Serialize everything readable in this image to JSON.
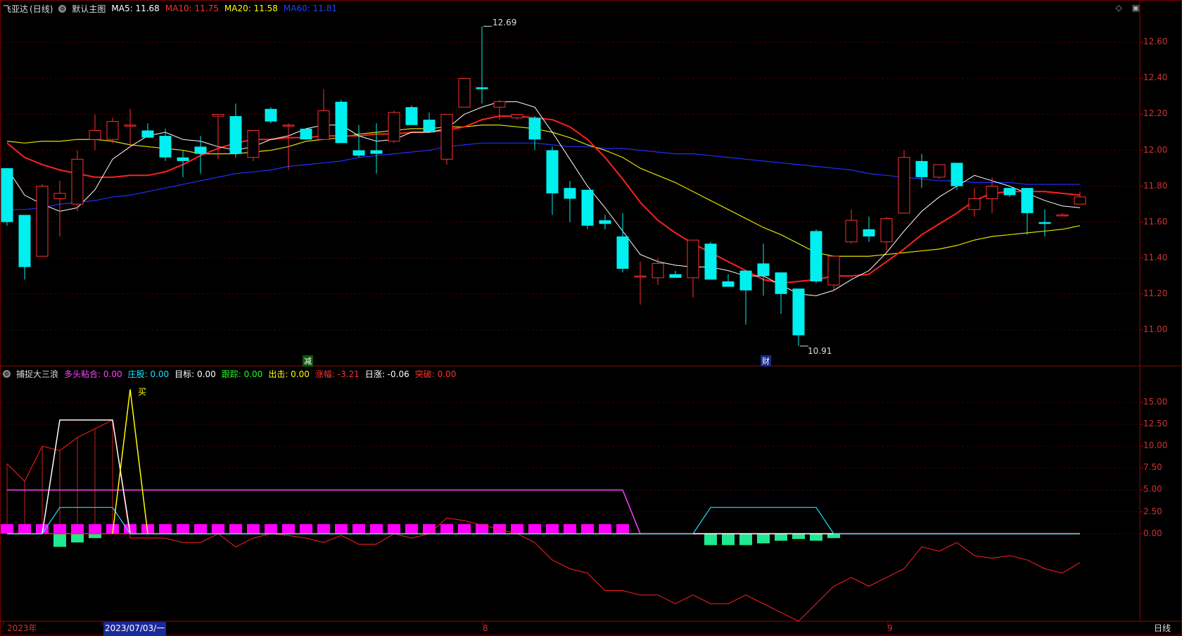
{
  "header": {
    "stock": "飞亚达",
    "period": "(日线)",
    "template": "默认主图",
    "ma": [
      {
        "label": "MA5: 11.68",
        "color": "#ffffff"
      },
      {
        "label": "MA10: 11.75",
        "color": "#ff3030"
      },
      {
        "label": "MA20: 11.58",
        "color": "#ffff00"
      },
      {
        "label": "MA60: 11.81",
        "color": "#2040ff"
      }
    ]
  },
  "sub_header": {
    "name": "捕捉大三浪",
    "items": [
      {
        "label": "多头粘合: 0.00",
        "color": "#ff40ff"
      },
      {
        "label": "庄股: 0.00",
        "color": "#20e0ff"
      },
      {
        "label": "目标: 0.00",
        "color": "#ffffff"
      },
      {
        "label": "跟踪: 0.00",
        "color": "#20ff20"
      },
      {
        "label": "出击: 0.00",
        "color": "#ffff00"
      },
      {
        "label": "涨幅: -3.21",
        "color": "#ff3030"
      },
      {
        "label": "日涨: -0.06",
        "color": "#ffffff"
      },
      {
        "label": "突破: 0.00",
        "color": "#ff3030"
      }
    ]
  },
  "annotations": {
    "high": "12.69",
    "low": "10.91",
    "buy": "买",
    "jian": "减",
    "cai": "财"
  },
  "bottom": {
    "year": "2023年",
    "date": "2023/07/03/一",
    "m8": "8",
    "m9": "9",
    "period_btn": "日线"
  },
  "chart_data": [
    {
      "type": "candlestick",
      "ylim": [
        10.8,
        12.75
      ],
      "yticks": [
        "12.60",
        "12.40",
        "12.20",
        "12.00",
        "11.80",
        "11.60",
        "11.40",
        "11.20",
        "11.00"
      ],
      "candles": [
        [
          11.9,
          11.9,
          11.58,
          11.6
        ],
        [
          11.64,
          11.6,
          11.28,
          11.35
        ],
        [
          11.41,
          11.81,
          11.41,
          11.8
        ],
        [
          11.73,
          11.83,
          11.52,
          11.76
        ],
        [
          11.7,
          12.0,
          11.66,
          11.95
        ],
        [
          12.06,
          12.2,
          12.0,
          12.11
        ],
        [
          12.06,
          12.18,
          12.04,
          12.16
        ],
        [
          12.14,
          12.23,
          12.02,
          12.14
        ],
        [
          12.11,
          12.15,
          12.07,
          12.07
        ],
        [
          12.08,
          12.12,
          11.94,
          11.96
        ],
        [
          11.96,
          12.0,
          11.85,
          11.94
        ],
        [
          12.02,
          12.08,
          11.87,
          11.98
        ],
        [
          12.19,
          12.2,
          11.95,
          12.2
        ],
        [
          12.19,
          12.26,
          11.96,
          11.98
        ],
        [
          11.96,
          12.09,
          11.94,
          12.11
        ],
        [
          12.23,
          12.24,
          12.15,
          12.16
        ],
        [
          12.14,
          12.15,
          11.89,
          12.14
        ],
        [
          12.12,
          12.12,
          12.06,
          12.06
        ],
        [
          12.06,
          12.34,
          12.06,
          12.22
        ],
        [
          12.27,
          12.28,
          12.04,
          12.04
        ],
        [
          12.0,
          12.14,
          11.96,
          11.97
        ],
        [
          12.0,
          12.15,
          11.87,
          11.98
        ],
        [
          12.05,
          12.22,
          12.04,
          12.21
        ],
        [
          12.24,
          12.25,
          12.14,
          12.14
        ],
        [
          12.17,
          12.21,
          12.13,
          12.1
        ],
        [
          11.95,
          12.2,
          11.92,
          12.2
        ],
        [
          12.24,
          12.4,
          12.24,
          12.4
        ],
        [
          12.35,
          12.69,
          12.26,
          12.34
        ],
        [
          12.24,
          12.28,
          12.17,
          12.27
        ],
        [
          12.18,
          12.2,
          12.17,
          12.2
        ],
        [
          12.18,
          12.19,
          12.0,
          12.06
        ],
        [
          12.0,
          12.02,
          11.64,
          11.76
        ],
        [
          11.79,
          11.83,
          11.6,
          11.73
        ],
        [
          11.78,
          11.78,
          11.56,
          11.58
        ],
        [
          11.61,
          11.64,
          11.56,
          11.59
        ],
        [
          11.52,
          11.65,
          11.32,
          11.34
        ],
        [
          11.3,
          11.38,
          11.14,
          11.3
        ],
        [
          11.29,
          11.4,
          11.25,
          11.37
        ],
        [
          11.31,
          11.33,
          11.3,
          11.29
        ],
        [
          11.29,
          11.5,
          11.18,
          11.5
        ],
        [
          11.48,
          11.49,
          11.3,
          11.28
        ],
        [
          11.27,
          11.31,
          11.24,
          11.24
        ],
        [
          11.33,
          11.33,
          11.03,
          11.22
        ],
        [
          11.37,
          11.48,
          11.19,
          11.3
        ],
        [
          11.32,
          11.31,
          11.09,
          11.2
        ],
        [
          11.23,
          11.22,
          10.91,
          10.97
        ],
        [
          11.55,
          11.56,
          11.26,
          11.27
        ],
        [
          11.25,
          11.4,
          11.22,
          11.41
        ],
        [
          11.49,
          11.67,
          11.48,
          11.61
        ],
        [
          11.56,
          11.63,
          11.49,
          11.52
        ],
        [
          11.49,
          11.63,
          11.44,
          11.62
        ],
        [
          11.65,
          12.0,
          11.65,
          11.96
        ],
        [
          11.94,
          11.98,
          11.79,
          11.85
        ],
        [
          11.85,
          11.92,
          11.84,
          11.92
        ],
        [
          11.93,
          11.91,
          11.78,
          11.8
        ],
        [
          11.67,
          11.79,
          11.63,
          11.73
        ],
        [
          11.73,
          11.85,
          11.65,
          11.8
        ],
        [
          11.79,
          11.79,
          11.74,
          11.75
        ],
        [
          11.79,
          11.77,
          11.53,
          11.65
        ],
        [
          11.6,
          11.67,
          11.52,
          11.59
        ],
        [
          11.64,
          11.65,
          11.64,
          11.64
        ],
        [
          11.7,
          11.77,
          11.71,
          11.74
        ]
      ],
      "ma5": [
        11.9,
        11.75,
        11.7,
        11.66,
        11.68,
        11.78,
        11.95,
        12.02,
        12.08,
        12.1,
        12.06,
        12.05,
        12.02,
        12.0,
        12.02,
        12.06,
        12.08,
        12.12,
        12.14,
        12.14,
        12.08,
        12.05,
        12.06,
        12.1,
        12.1,
        12.12,
        12.2,
        12.24,
        12.27,
        12.27,
        12.24,
        12.1,
        11.95,
        11.8,
        11.68,
        11.55,
        11.42,
        11.38,
        11.36,
        11.35,
        11.35,
        11.33,
        11.3,
        11.3,
        11.25,
        11.2,
        11.19,
        11.22,
        11.28,
        11.33,
        11.43,
        11.55,
        11.66,
        11.74,
        11.8,
        11.86,
        11.83,
        11.8,
        11.76,
        11.72,
        11.69,
        11.68
      ],
      "ma10": [
        12.04,
        11.96,
        11.92,
        11.89,
        11.87,
        11.85,
        11.85,
        11.86,
        11.86,
        11.88,
        11.92,
        11.97,
        12.01,
        12.04,
        12.06,
        12.06,
        12.07,
        12.07,
        12.08,
        12.08,
        12.08,
        12.09,
        12.09,
        12.1,
        12.1,
        12.11,
        12.13,
        12.17,
        12.19,
        12.19,
        12.18,
        12.17,
        12.13,
        12.06,
        11.96,
        11.84,
        11.71,
        11.61,
        11.54,
        11.48,
        11.43,
        11.38,
        11.33,
        11.28,
        11.26,
        11.27,
        11.28,
        11.3,
        11.3,
        11.31,
        11.38,
        11.45,
        11.53,
        11.59,
        11.65,
        11.72,
        11.76,
        11.77,
        11.77,
        11.77,
        11.76,
        11.75
      ],
      "ma20": [
        12.05,
        12.04,
        12.05,
        12.05,
        12.06,
        12.06,
        12.05,
        12.03,
        12.02,
        12.01,
        12.0,
        11.98,
        11.98,
        11.98,
        11.99,
        12.0,
        12.02,
        12.05,
        12.06,
        12.07,
        12.09,
        12.1,
        12.11,
        12.12,
        12.12,
        12.13,
        12.13,
        12.14,
        12.14,
        12.13,
        12.12,
        12.1,
        12.07,
        12.03,
        12.0,
        11.96,
        11.9,
        11.86,
        11.82,
        11.77,
        11.72,
        11.67,
        11.62,
        11.57,
        11.53,
        11.48,
        11.43,
        11.41,
        11.41,
        11.41,
        11.42,
        11.43,
        11.44,
        11.45,
        11.47,
        11.5,
        11.52,
        11.53,
        11.54,
        11.55,
        11.56,
        11.58
      ],
      "ma60": [
        11.67,
        11.67,
        11.68,
        11.7,
        11.71,
        11.72,
        11.74,
        11.75,
        11.77,
        11.79,
        11.81,
        11.83,
        11.85,
        11.87,
        11.88,
        11.89,
        11.91,
        11.92,
        11.93,
        11.94,
        11.96,
        11.97,
        11.98,
        11.99,
        12.0,
        12.02,
        12.03,
        12.04,
        12.04,
        12.04,
        12.04,
        12.03,
        12.02,
        12.02,
        12.01,
        12.01,
        12.0,
        11.99,
        11.98,
        11.98,
        11.97,
        11.96,
        11.95,
        11.94,
        11.93,
        11.92,
        11.91,
        11.9,
        11.89,
        11.87,
        11.86,
        11.85,
        11.84,
        11.83,
        11.83,
        11.82,
        11.82,
        11.82,
        11.81,
        11.81,
        11.81,
        11.81
      ]
    },
    {
      "type": "line",
      "ylim": [
        -10,
        17.5
      ],
      "yticks": [
        "15.00",
        "12.50",
        "10.00",
        "7.50",
        "5.00",
        "2.50",
        "0.00"
      ],
      "white": [
        0,
        0,
        0,
        13,
        13,
        13,
        13,
        0,
        0,
        0,
        0,
        0,
        0,
        0,
        0,
        0,
        0,
        0,
        0,
        0,
        0,
        0,
        0,
        0,
        0,
        0,
        0,
        0,
        0,
        0,
        0,
        0,
        0,
        0,
        0,
        0,
        0,
        0,
        0,
        0,
        0,
        0,
        0,
        0,
        0,
        0,
        0,
        0,
        0,
        0,
        0,
        0,
        0,
        0,
        0,
        0,
        0,
        0,
        0,
        0,
        0,
        0
      ],
      "cyan": [
        0,
        0,
        0,
        3,
        3,
        3,
        3,
        0,
        0,
        0,
        0,
        0,
        0,
        0,
        0,
        0,
        0,
        0,
        0,
        0,
        0,
        0,
        0,
        0,
        0,
        0,
        0,
        0,
        0,
        0,
        0,
        0,
        0,
        0,
        0,
        0,
        0,
        0,
        0,
        0,
        3,
        3,
        3,
        3,
        3,
        3,
        3,
        0,
        0,
        0,
        0,
        0,
        0,
        0,
        0,
        0,
        0,
        0,
        0,
        0,
        0,
        0
      ],
      "yellow_peak": {
        "from": 6,
        "peak": 7,
        "to": 8,
        "value": 16.5
      },
      "magenta": [
        5,
        5,
        5,
        5,
        5,
        5,
        5,
        5,
        5,
        5,
        5,
        5,
        5,
        5,
        5,
        5,
        5,
        5,
        5,
        5,
        5,
        5,
        5,
        5,
        5,
        5,
        5,
        5,
        5,
        5,
        5,
        5,
        5,
        5,
        5,
        5,
        0,
        0,
        0,
        0,
        0,
        0,
        0,
        0,
        0,
        0,
        0,
        0,
        0,
        0,
        0,
        0,
        0,
        0,
        0,
        0,
        0,
        0,
        0,
        0,
        0,
        0
      ],
      "red_line": [
        8,
        6,
        10,
        9.5,
        11,
        12,
        13,
        -0.5,
        -0.5,
        -0.5,
        -1,
        -1,
        0,
        -1.5,
        -0.5,
        0,
        -0.2,
        -0.5,
        -1,
        -0.2,
        -1.2,
        -1.2,
        0,
        -0.5,
        0,
        1.8,
        1.5,
        1,
        0.5,
        0,
        -1,
        -3,
        -4,
        -4.5,
        -6.5,
        -6.5,
        -7,
        -7,
        -8,
        -7,
        -8,
        -8,
        -7,
        -8,
        -9,
        -10,
        -8,
        -6,
        -5,
        -6,
        -5,
        -4,
        -1.5,
        -2,
        -1,
        -2.5,
        -2.8,
        -2.5,
        -3,
        -4,
        -4.5,
        -3.3
      ],
      "red_bars": [
        8,
        6,
        10,
        9.5,
        11,
        12,
        13
      ],
      "pink_bars_count": 36,
      "green_bars": {
        "3": -1.5,
        "4": -1,
        "5": -0.5,
        "40": -1.3,
        "41": -1.3,
        "42": -1.3,
        "43": -1.1,
        "44": -0.8,
        "45": -0.6,
        "46": -0.8,
        "47": -0.5
      }
    }
  ]
}
